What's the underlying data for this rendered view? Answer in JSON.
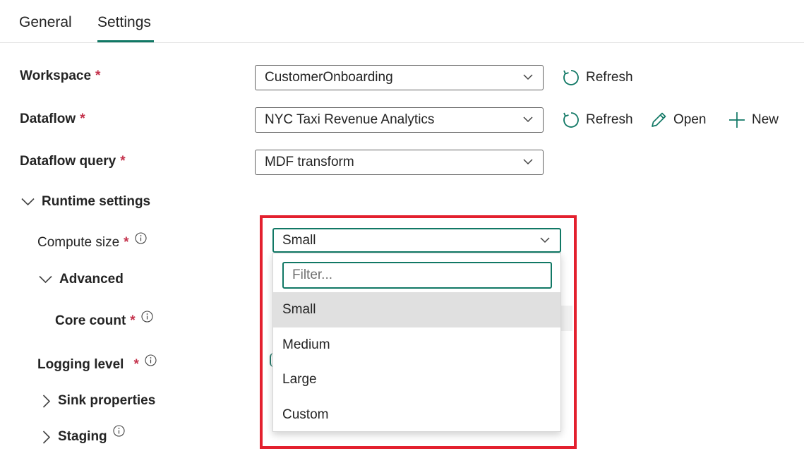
{
  "tabs": [
    {
      "label": "General",
      "active": false
    },
    {
      "label": "Settings",
      "active": true
    }
  ],
  "required_mark": "*",
  "workspace": {
    "label": "Workspace",
    "value": "CustomerOnboarding",
    "refresh_label": "Refresh"
  },
  "dataflow": {
    "label": "Dataflow",
    "value": "NYC Taxi Revenue Analytics",
    "refresh_label": "Refresh",
    "open_label": "Open",
    "new_label": "New"
  },
  "dataflow_query": {
    "label": "Dataflow query",
    "value": "MDF transform"
  },
  "runtime_settings": {
    "label": "Runtime settings",
    "compute_size": {
      "label": "Compute size",
      "value": "Small",
      "filter_placeholder": "Filter...",
      "options": [
        "Small",
        "Medium",
        "Large",
        "Custom"
      ]
    },
    "advanced": {
      "label": "Advanced",
      "core_count_label": "Core count"
    },
    "logging_level_label": "Logging level",
    "sink_properties_label": "Sink properties",
    "staging_label": "Staging"
  },
  "colors": {
    "accent": "#117865",
    "required": "#c4314b",
    "highlight": "#e3202e"
  }
}
